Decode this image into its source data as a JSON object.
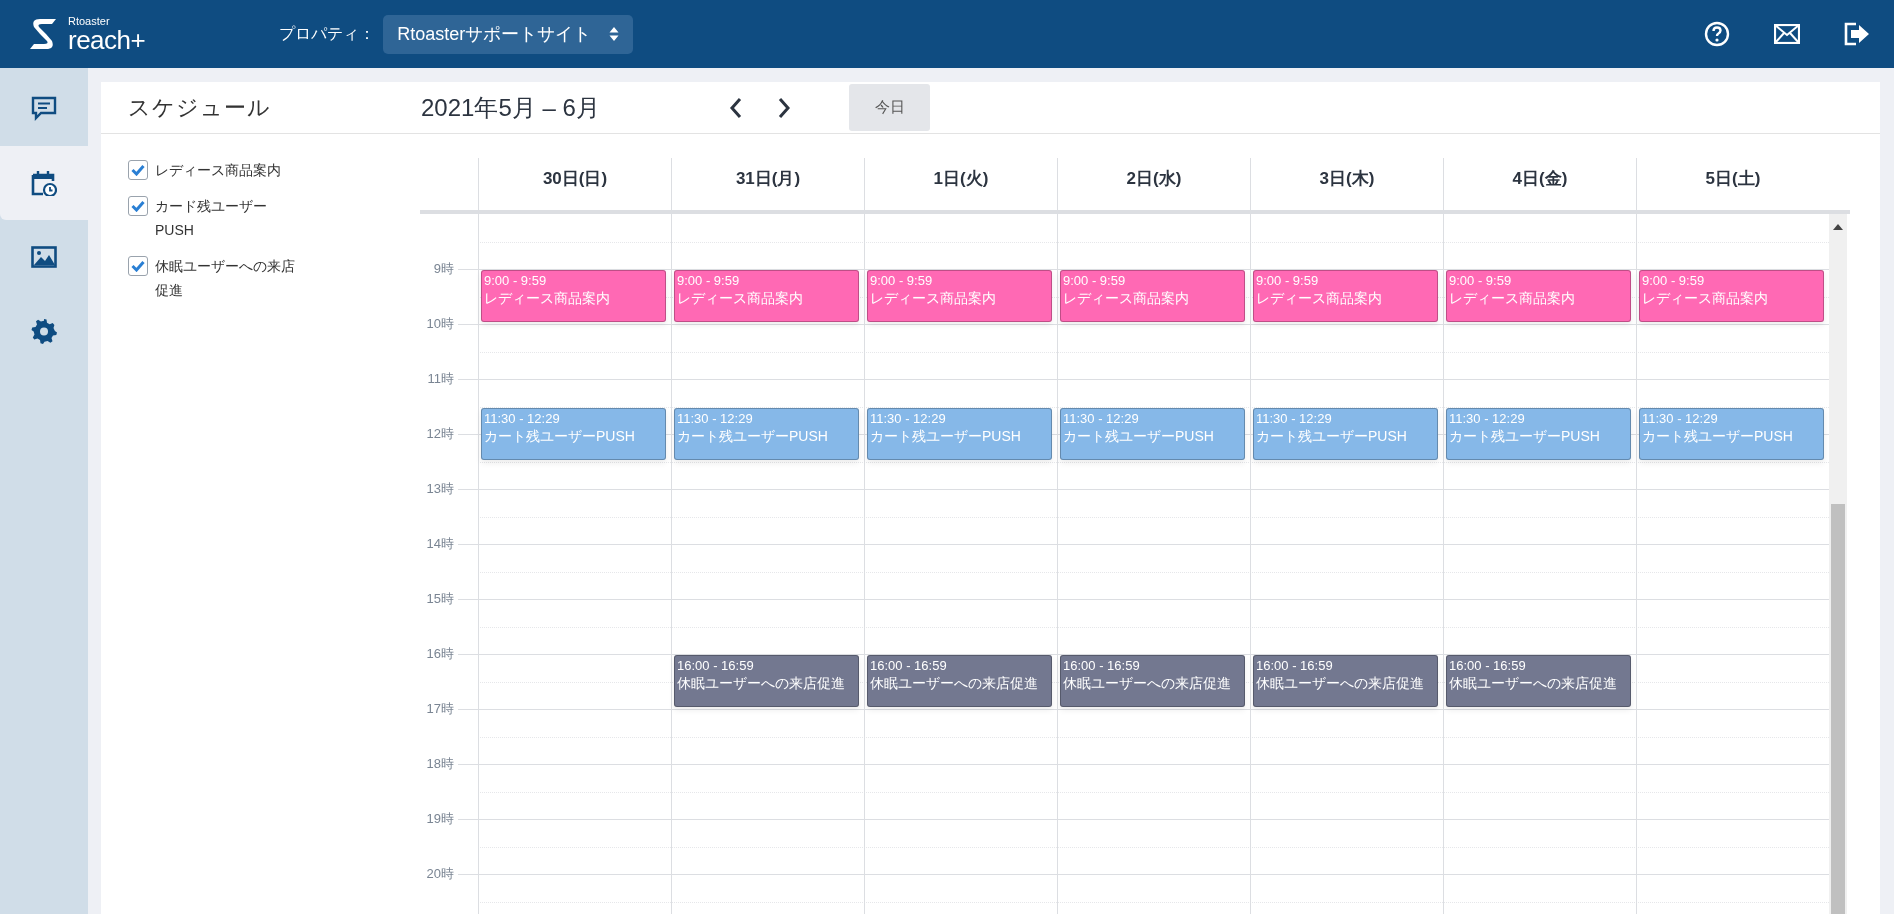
{
  "header": {
    "logo_small": "Rtoaster",
    "logo_big": "reach+",
    "property_label": "プロパティ：",
    "property_value": "Rtoasterサポートサイト"
  },
  "sidebar": {
    "items": [
      {
        "kind": "messages",
        "selected": false
      },
      {
        "kind": "schedule",
        "selected": true
      },
      {
        "kind": "images",
        "selected": false
      },
      {
        "kind": "settings",
        "selected": false
      }
    ]
  },
  "page": {
    "title": "スケジュール",
    "range": "2021年5月 – 6月",
    "today_button": "今日"
  },
  "filters": [
    {
      "label": "レディース商品案内",
      "checked": true
    },
    {
      "label": "カード残ユーザーPUSH",
      "checked": true
    },
    {
      "label": "休眠ユーザーへの来店促進",
      "checked": true
    }
  ],
  "calendar": {
    "hours": [
      "9時",
      "10時",
      "11時",
      "12時",
      "13時",
      "14時",
      "15時",
      "16時",
      "17時",
      "18時",
      "19時",
      "20時"
    ],
    "days": [
      {
        "label": "30日(日)",
        "events": [
          {
            "time": "9:00 - 9:59",
            "title": "レディース商品案内",
            "color": "#ff69b4"
          },
          {
            "time": "11:30 - 12:29",
            "title": "カート残ユーザーPUSH",
            "color": "#86b8e8"
          }
        ]
      },
      {
        "label": "31日(月)",
        "events": [
          {
            "time": "9:00 - 9:59",
            "title": "レディース商品案内",
            "color": "#ff69b4"
          },
          {
            "time": "11:30 - 12:29",
            "title": "カート残ユーザーPUSH",
            "color": "#86b8e8"
          },
          {
            "time": "16:00 - 16:59",
            "title": "休眠ユーザーへの来店促進",
            "color": "#737890"
          }
        ]
      },
      {
        "label": "1日(火)",
        "events": [
          {
            "time": "9:00 - 9:59",
            "title": "レディース商品案内",
            "color": "#ff69b4"
          },
          {
            "time": "11:30 - 12:29",
            "title": "カート残ユーザーPUSH",
            "color": "#86b8e8"
          },
          {
            "time": "16:00 - 16:59",
            "title": "休眠ユーザーへの来店促進",
            "color": "#737890"
          }
        ]
      },
      {
        "label": "2日(水)",
        "events": [
          {
            "time": "9:00 - 9:59",
            "title": "レディース商品案内",
            "color": "#ff69b4"
          },
          {
            "time": "11:30 - 12:29",
            "title": "カート残ユーザーPUSH",
            "color": "#86b8e8"
          },
          {
            "time": "16:00 - 16:59",
            "title": "休眠ユーザーへの来店促進",
            "color": "#737890"
          }
        ]
      },
      {
        "label": "3日(木)",
        "events": [
          {
            "time": "9:00 - 9:59",
            "title": "レディース商品案内",
            "color": "#ff69b4"
          },
          {
            "time": "11:30 - 12:29",
            "title": "カート残ユーザーPUSH",
            "color": "#86b8e8"
          },
          {
            "time": "16:00 - 16:59",
            "title": "休眠ユーザーへの来店促進",
            "color": "#737890"
          }
        ]
      },
      {
        "label": "4日(金)",
        "events": [
          {
            "time": "9:00 - 9:59",
            "title": "レディース商品案内",
            "color": "#ff69b4"
          },
          {
            "time": "11:30 - 12:29",
            "title": "カート残ユーザーPUSH",
            "color": "#86b8e8"
          },
          {
            "time": "16:00 - 16:59",
            "title": "休眠ユーザーへの来店促進",
            "color": "#737890"
          }
        ]
      },
      {
        "label": "5日(土)",
        "events": [
          {
            "time": "9:00 - 9:59",
            "title": "レディース商品案内",
            "color": "#ff69b4"
          },
          {
            "time": "11:30 - 12:29",
            "title": "カート残ユーザーPUSH",
            "color": "#86b8e8"
          }
        ]
      }
    ]
  }
}
